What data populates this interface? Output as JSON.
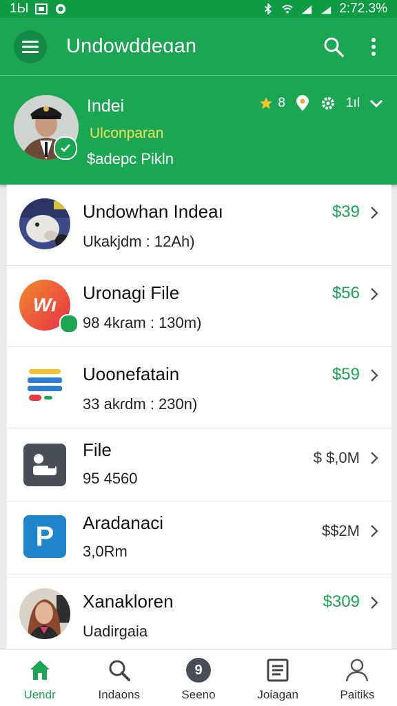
{
  "status_bar": {
    "left_text": "1Ы",
    "right_text": "2:72.3%"
  },
  "app_bar": {
    "title": "Undowddeɑan"
  },
  "profile": {
    "name": "Indei",
    "subtitle": "Ulconparan",
    "balance": "$adepc Pikln",
    "rating": "8",
    "signal_text": "1ıl"
  },
  "list_items": [
    {
      "title": "Undowhan Indeaı",
      "subtitle": "Ukakjdm : 12Ah)",
      "price": "$39"
    },
    {
      "title": "Uronagi File",
      "subtitle": "98 4kɾam : 130m)",
      "price": "$56",
      "logo_text": "Wı"
    },
    {
      "title": "Uoonefatain",
      "subtitle": "33 akɾdm : 230n)",
      "price": "$59"
    },
    {
      "title": "File",
      "subtitle": "95  4560",
      "price": "$ $,0M"
    },
    {
      "title": "Aradanaci",
      "subtitle": "3,0Rm",
      "price": "$$2M",
      "logo_text": "P"
    },
    {
      "title": "Xanakloren",
      "subtitle": "Uadirgaia",
      "price": "$309"
    }
  ],
  "bottom_nav": [
    {
      "label": "Uendr",
      "icon": "home-icon",
      "active": true
    },
    {
      "label": "Indaons",
      "icon": "search-icon",
      "active": false
    },
    {
      "label": "Seeno",
      "icon": "badge-9-icon",
      "active": false,
      "badge": "9"
    },
    {
      "label": "Joiagan",
      "icon": "document-icon",
      "active": false
    },
    {
      "label": "Paitiks",
      "icon": "person-icon",
      "active": false
    }
  ],
  "colors": {
    "primary": "#1aa653",
    "primary_dark": "#0f9a44",
    "accent_yellow": "#f2e35a",
    "price_green": "#1aa653"
  }
}
